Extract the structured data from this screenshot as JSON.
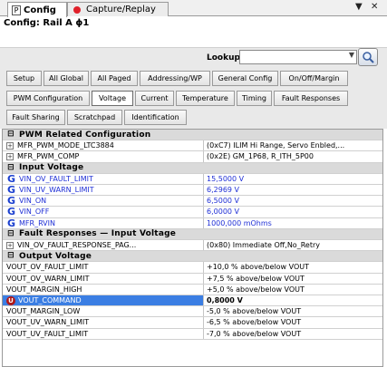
{
  "tabs": {
    "active": "Config",
    "active_icon": "P",
    "inactive": "Capture/Replay",
    "dropdown_glyph": "▼",
    "close_glyph": "✕"
  },
  "config_title": "Config: Rail A ɸ1",
  "lookup": {
    "label": "Lookup:",
    "value": ""
  },
  "toolbar": {
    "row1": [
      "Setup",
      "All Global",
      "All Paged",
      "Addressing/WP",
      "General Config",
      "On/Off/Margin"
    ],
    "row2": [
      "PWM Configuration",
      "Voltage",
      "Current",
      "Temperature",
      "Timing",
      "Fault Responses"
    ],
    "row3": [
      "Fault Sharing",
      "Scratchpad",
      "Identification"
    ],
    "selected": "Voltage"
  },
  "grid": {
    "sections": {
      "pwm": "PWM Related Configuration",
      "input_voltage": "Input Voltage",
      "fault_responses": "Fault Responses — Input Voltage",
      "output_voltage": "Output Voltage"
    },
    "pwm_rows": [
      {
        "name": "MFR_PWM_MODE_LTC3884",
        "value": "(0xC7) ILIM Hi Range, Servo Enbled,..."
      },
      {
        "name": "MFR_PWM_COMP",
        "value": "(0x2E) GM_1P68, R_ITH_5P00"
      }
    ],
    "input_rows": [
      {
        "name": "VIN_OV_FAULT_LIMIT",
        "value": "15,5000 V"
      },
      {
        "name": "VIN_UV_WARN_LIMIT",
        "value": "6,2969 V"
      },
      {
        "name": "VIN_ON",
        "value": "6,5000 V"
      },
      {
        "name": "VIN_OFF",
        "value": "6,0000 V"
      },
      {
        "name": "MFR_RVIN",
        "value": "1000,000 mOhms"
      }
    ],
    "fault_rows": [
      {
        "name": "VIN_OV_FAULT_RESPONSE_PAG...",
        "value": "(0x80) Immediate Off,No_Retry"
      }
    ],
    "output_rows": [
      {
        "name": "VOUT_OV_FAULT_LIMIT",
        "value": "+10,0 % above/below VOUT"
      },
      {
        "name": "VOUT_OV_WARN_LIMIT",
        "value": "+7,5 % above/below VOUT"
      },
      {
        "name": "VOUT_MARGIN_HIGH",
        "value": "+5,0 % above/below VOUT"
      },
      {
        "name": "VOUT_COMMAND",
        "value": "0,8000 V"
      },
      {
        "name": "VOUT_MARGIN_LOW",
        "value": "-5,0 % above/below VOUT"
      },
      {
        "name": "VOUT_UV_WARN_LIMIT",
        "value": "-6,5 % above/below VOUT"
      },
      {
        "name": "VOUT_UV_FAULT_LIMIT",
        "value": "-7,0 % above/below VOUT"
      }
    ],
    "section_glyph": "⊟",
    "expand_glyph": "+",
    "g_glyph": "G",
    "u_glyph": "U"
  },
  "colors": {
    "link_blue": "#1f2fd6",
    "selection": "#3b7ee3",
    "section_bg": "#dadada"
  }
}
